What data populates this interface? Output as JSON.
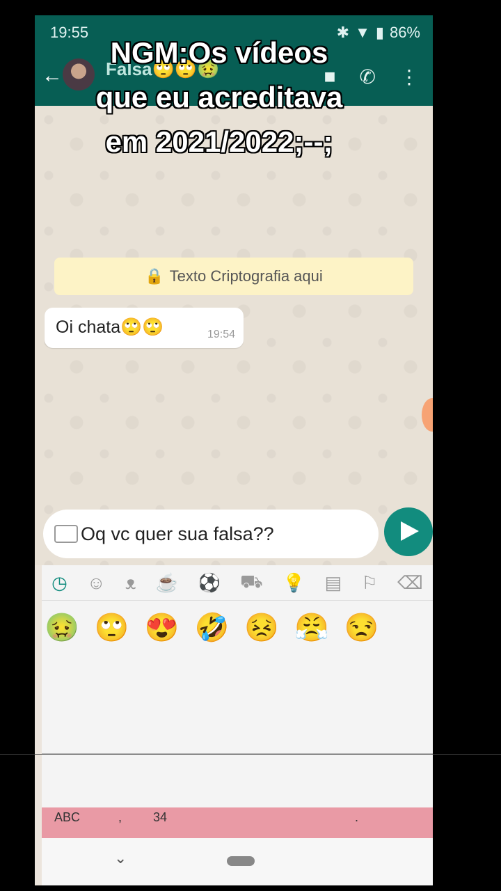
{
  "caption": {
    "line1": "NGM:Os vídeos",
    "line2": "que eu acreditava",
    "line3": "em 2021/2022;--;"
  },
  "status_bar": {
    "time": "19:55",
    "battery": "86%"
  },
  "chat_header": {
    "contact_name": "Falsa🙄🙄🤢",
    "icons": [
      "back-arrow-icon",
      "avatar",
      "video-call-icon",
      "phone-icon",
      "more-icon"
    ]
  },
  "encryption_notice": {
    "text": "Texto Criptografia aqui",
    "icon": "lock-icon"
  },
  "messages": [
    {
      "text": "Oi chata🙄🙄",
      "time": "19:54"
    }
  ],
  "composer": {
    "value": "Oq vc quer sua falsa??",
    "send_icon": "send-icon"
  },
  "emoji_keyboard": {
    "tabs": [
      "recent-icon",
      "smiley-icon",
      "animal-icon",
      "food-icon",
      "sports-icon",
      "travel-icon",
      "objects-icon",
      "symbols-icon",
      "flag-icon",
      "backspace-icon"
    ],
    "recent_emojis": [
      "🤢",
      "🙄",
      "😍",
      "🤣",
      "😣",
      "😤",
      "😒"
    ],
    "keys": {
      "abc": "ABC",
      "comma": ",",
      "num": "34",
      "period": "."
    }
  },
  "colors": {
    "header": "#075e54",
    "accent": "#128c7e",
    "encryption_bg": "#fdf3c6",
    "chat_bg": "#e8e1d6"
  }
}
